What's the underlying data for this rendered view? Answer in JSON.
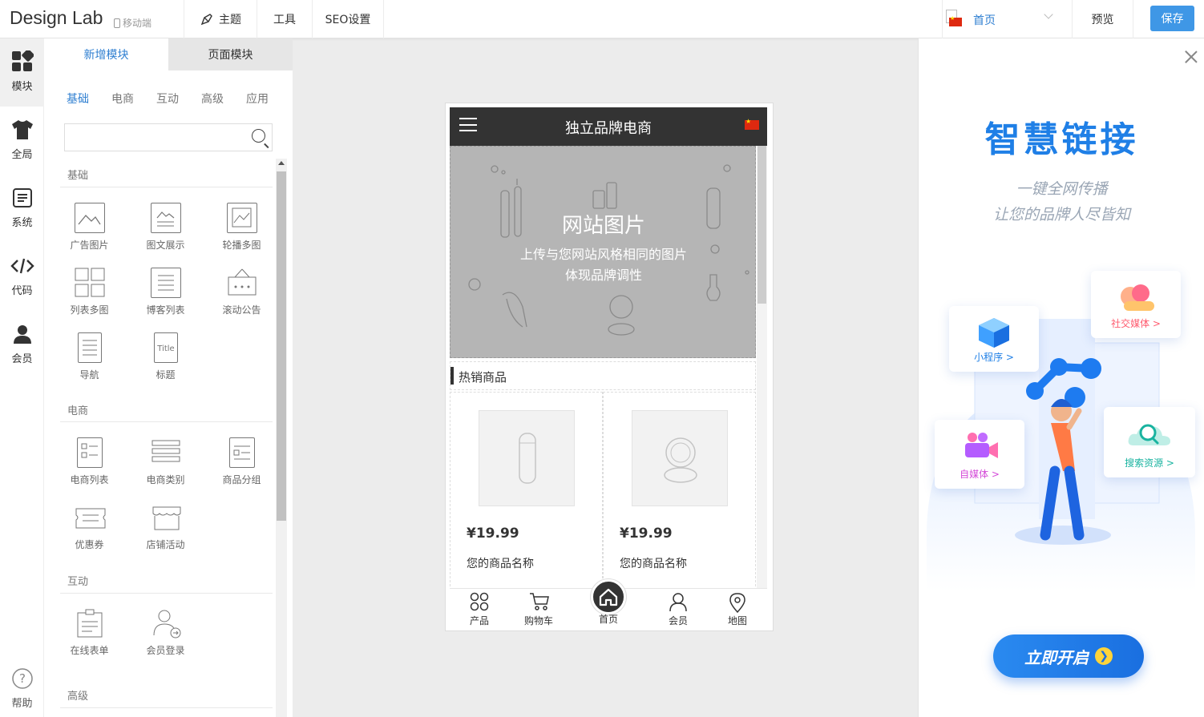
{
  "topbar": {
    "logo": "Design Lab",
    "mobile_tag": "移动端",
    "nav": [
      {
        "label": "主题"
      },
      {
        "label": "工具"
      },
      {
        "label": "SEO设置"
      }
    ],
    "page_select": "首页",
    "preview": "预览",
    "save": "保存"
  },
  "rail": [
    {
      "label": "模块",
      "icon": "modules-icon"
    },
    {
      "label": "全局",
      "icon": "shirt-icon"
    },
    {
      "label": "系统",
      "icon": "system-icon"
    },
    {
      "label": "代码",
      "icon": "code-icon"
    },
    {
      "label": "会员",
      "icon": "member-icon"
    },
    {
      "label": "帮助",
      "icon": "help-icon"
    }
  ],
  "panel": {
    "tabs": [
      "新增模块",
      "页面模块"
    ],
    "subtabs": [
      "基础",
      "电商",
      "互动",
      "高级",
      "应用"
    ],
    "search_placeholder": "",
    "sections": {
      "basic": {
        "title": "基础",
        "items": [
          "广告图片",
          "图文展示",
          "轮播多图",
          "列表多图",
          "博客列表",
          "滚动公告",
          "导航",
          "标题"
        ]
      },
      "ecommerce": {
        "title": "电商",
        "items": [
          "电商列表",
          "电商类别",
          "商品分组",
          "优惠券",
          "店铺活动"
        ]
      },
      "interactive": {
        "title": "互动",
        "items": [
          "在线表单",
          "会员登录"
        ]
      },
      "advanced": {
        "title": "高级"
      }
    }
  },
  "phone": {
    "title": "独立品牌电商",
    "banner_title": "网站图片",
    "banner_line1": "上传与您网站风格相同的图片",
    "banner_line2": "体现品牌调性",
    "hot_title": "热销商品",
    "products": [
      {
        "price": "¥19.99",
        "name": "您的商品名称"
      },
      {
        "price": "¥19.99",
        "name": "您的商品名称"
      }
    ],
    "bottom_nav": [
      "产品",
      "购物车",
      "首页",
      "会员",
      "地图"
    ]
  },
  "promo": {
    "title": "智慧链接",
    "sub1": "一键全网传播",
    "sub2": "让您的品牌人尽皆知",
    "cards": {
      "miniapp": "小程序 >",
      "social": "社交媒体 >",
      "selfmedia": "自媒体 >",
      "search": "搜索资源 >"
    },
    "cta": "立即开启"
  },
  "colors": {
    "accent": "#3f97e6",
    "link": "#2f7fd1",
    "phone_header": "#333333",
    "banner": "#b5b5b5"
  }
}
